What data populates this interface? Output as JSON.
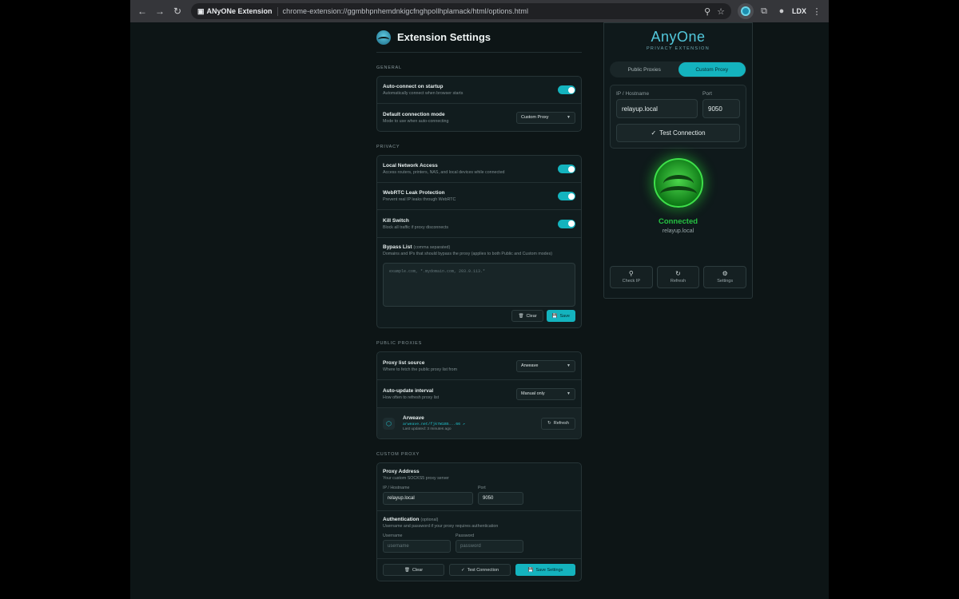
{
  "browser": {
    "ext_chip": "ANyONe Extension",
    "url": "chrome-extension://ggmbhpnhemdnkigcfnghpollhplamack/html/options.html",
    "profile": "LDX"
  },
  "settings": {
    "title": "Extension Settings",
    "general": {
      "label": "GENERAL",
      "autoconnect_title": "Auto-connect on startup",
      "autoconnect_desc": "Automatically connect when browser starts",
      "mode_title": "Default connection mode",
      "mode_desc": "Mode to use when auto-connecting",
      "mode_value": "Custom Proxy"
    },
    "privacy": {
      "label": "PRIVACY",
      "lan_title": "Local Network Access",
      "lan_desc": "Access routers, printers, NAS, and local devices while connected",
      "webrtc_title": "WebRTC Leak Protection",
      "webrtc_desc": "Prevent real IP leaks through WebRTC",
      "kill_title": "Kill Switch",
      "kill_desc": "Block all traffic if proxy disconnects",
      "bypass_title": "Bypass List",
      "bypass_hint": "(comma separated)",
      "bypass_desc": "Domains and IPs that should bypass the proxy (applies to both Public and Custom modes)",
      "bypass_placeholder": "example.com, *.mydomain.com, 203.0.113.*",
      "clear_label": "Clear",
      "save_label": "Save"
    },
    "public": {
      "label": "PUBLIC PROXIES",
      "source_title": "Proxy list source",
      "source_desc": "Where to fetch the public proxy list from",
      "source_value": "Arweave",
      "interval_title": "Auto-update interval",
      "interval_desc": "How often to refresh proxy list",
      "interval_value": "Manual only",
      "src_name": "Arweave",
      "src_url": "arweave.net/fjk7W1B5...66",
      "src_updated": "Last updated: 3 minutes ago",
      "refresh_label": "Refresh"
    },
    "custom": {
      "label": "CUSTOM PROXY",
      "addr_title": "Proxy Address",
      "addr_desc": "Your custom SOCKS5 proxy server",
      "host_label": "IP / Hostname",
      "host_value": "relayup.local",
      "port_label": "Port",
      "port_value": "9050",
      "auth_title": "Authentication",
      "auth_opt": "(optional)",
      "auth_desc": "Username and password if your proxy requires authentication",
      "user_label": "Username",
      "user_placeholder": "username",
      "pass_label": "Password",
      "pass_placeholder": "password",
      "clear_label": "Clear",
      "test_label": "Test Connection",
      "save_label": "Save Settings"
    }
  },
  "popup": {
    "brand": "AnyOne",
    "tagline": "PRIVACY EXTENSION",
    "tab_public": "Public Proxies",
    "tab_custom": "Custom Proxy",
    "host_label": "IP / Hostname",
    "host_value": "relayup.local",
    "port_label": "Port",
    "port_value": "9050",
    "test_label": "Test Connection",
    "status": "Connected",
    "status_host": "relayup.local",
    "act_check": "Check IP",
    "act_refresh": "Refresh",
    "act_settings": "Settings"
  }
}
